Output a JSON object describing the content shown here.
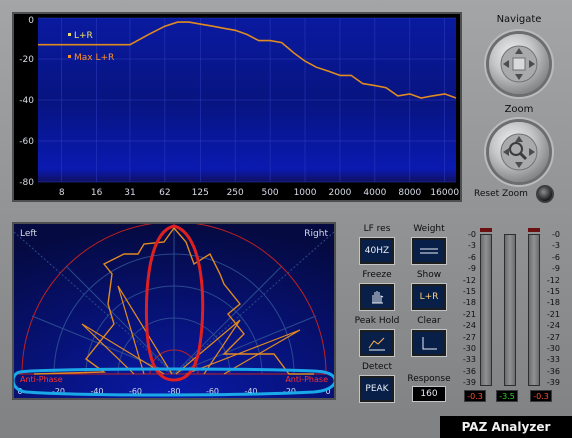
{
  "spectrum": {
    "y_ticks": [
      "0",
      "-20",
      "-40",
      "-60",
      "-80"
    ],
    "x_ticks": [
      "8",
      "16",
      "31",
      "62",
      "125",
      "250",
      "500",
      "1000",
      "2000",
      "4000",
      "8000",
      "16000"
    ],
    "legend": [
      {
        "label": "L+R",
        "color": "#f0e060"
      },
      {
        "label": "Max L+R",
        "color": "#ff9020"
      }
    ]
  },
  "chart_data": {
    "type": "line",
    "ylim": [
      -80,
      0
    ],
    "x_scale": "log",
    "x": [
      5,
      10,
      20,
      31,
      45,
      62,
      80,
      100,
      125,
      160,
      200,
      250,
      315,
      400,
      500,
      630,
      800,
      1000,
      1250,
      1600,
      2000,
      2500,
      3150,
      4000,
      5000,
      6300,
      8000,
      10000,
      12500,
      16000,
      20000
    ],
    "series": [
      {
        "name": "Max L+R",
        "values": [
          -13,
          -13,
          -13,
          -13,
          -8,
          -4,
          -2,
          -2,
          -3,
          -4,
          -5,
          -6,
          -8,
          -11,
          -11,
          -12,
          -17,
          -21,
          -24,
          -26,
          -28,
          -28,
          -32,
          -33,
          -34,
          -38,
          -37,
          -39,
          -38,
          -37,
          -39
        ]
      }
    ]
  },
  "navigate": {
    "label": "Navigate"
  },
  "zoom": {
    "label": "Zoom",
    "reset_label": "Reset Zoom"
  },
  "phase": {
    "left_label": "Left",
    "right_label": "Right",
    "anti_phase_left": "Anti-Phase",
    "anti_phase_right": "Anti-Phase",
    "bottom_ticks": [
      "0",
      "-20",
      "-40",
      "-60",
      "-80",
      "-60",
      "-40",
      "-20",
      "0"
    ]
  },
  "controls": {
    "lf_res": {
      "label": "LF res",
      "value": "40HZ"
    },
    "weight": {
      "label": "Weight",
      "icon": "double-line-icon"
    },
    "freeze": {
      "label": "Freeze",
      "icon": "hand-icon"
    },
    "show": {
      "label": "Show",
      "value": "L+R"
    },
    "peak_hold": {
      "label": "Peak Hold",
      "icon": "peak-hold-icon"
    },
    "clear": {
      "label": "Clear",
      "icon": "clear-icon"
    },
    "detect": {
      "label": "Detect",
      "value": "PEAK"
    },
    "response": {
      "label": "Response",
      "value": "160"
    }
  },
  "meters": {
    "scale": [
      "-0",
      "-3",
      "-6",
      "-9",
      "-12",
      "-15",
      "-18",
      "-21",
      "-24",
      "-27",
      "-30",
      "-33",
      "-36",
      "-39"
    ],
    "readouts": [
      {
        "value": "-0.3",
        "color": "#ff5030"
      },
      {
        "value": "-3.5",
        "color": "#30d030"
      },
      {
        "value": "-0.3",
        "color": "#ff5030"
      }
    ]
  },
  "brand": {
    "name": "PAZ Analyzer"
  },
  "colors": {
    "screen_blue": "#0a1aa8",
    "trace_orange": "#e08a20",
    "annotation_red": "#e02020",
    "annotation_cyan": "#1aa8e8"
  }
}
